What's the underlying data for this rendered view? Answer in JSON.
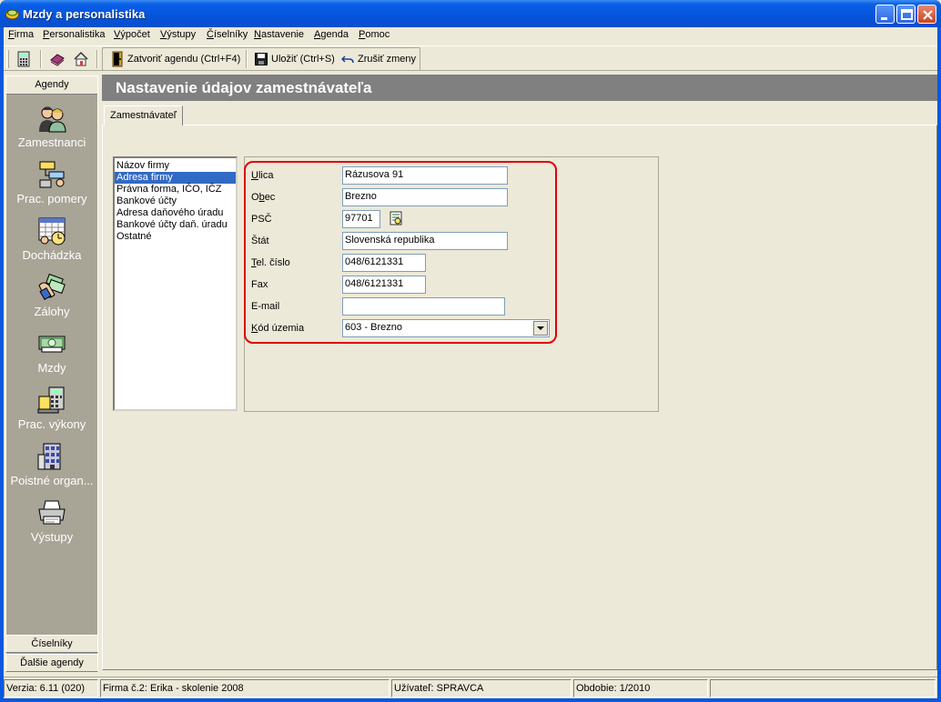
{
  "window": {
    "title": "Mzdy a personalistika"
  },
  "menu": [
    {
      "label": "Firma",
      "key": "F",
      "rest": "irma"
    },
    {
      "label": "Personalistika",
      "key": "P",
      "rest": "ersonalistika"
    },
    {
      "label": "Výpočet",
      "key": "V",
      "rest": "ýpočet"
    },
    {
      "label": "Výstupy",
      "key": "V",
      "rest": "ýstupy"
    },
    {
      "label": "Číselníky",
      "key": "Č",
      "rest": "íselníky"
    },
    {
      "label": "Nastavenie",
      "key": "N",
      "rest": "astavenie"
    },
    {
      "label": "Agenda",
      "key": "A",
      "rest": "genda"
    },
    {
      "label": "Pomoc",
      "key": "P",
      "rest": "omoc"
    }
  ],
  "toolbar": {
    "close_agenda": "Zatvoriť agendu (Ctrl+F4)",
    "save": "Uložiť (Ctrl+S)",
    "undo": "Zrušiť zmeny"
  },
  "sidebar": {
    "header": "Agendy",
    "items": [
      {
        "label": "Zamestnanci",
        "icon": "employees-icon"
      },
      {
        "label": "Prac. pomery",
        "icon": "org-chart-icon"
      },
      {
        "label": "Dochádzka",
        "icon": "attendance-calendar-icon"
      },
      {
        "label": "Zálohy",
        "icon": "cash-advance-icon"
      },
      {
        "label": "Mzdy",
        "icon": "money-icon"
      },
      {
        "label": "Prac. výkony",
        "icon": "work-performance-icon"
      },
      {
        "label": "Poistné organ...",
        "icon": "insurance-building-icon"
      },
      {
        "label": "Výstupy",
        "icon": "printer-icon"
      }
    ],
    "footer": [
      "Číselníky",
      "Ďalšie agendy"
    ]
  },
  "main": {
    "title": "Nastavenie údajov zamestnávateľa",
    "tab": "Zamestnávateľ",
    "sections": [
      "Názov firmy",
      "Adresa firmy",
      "Právna forma, IČO, IČZ",
      "Bankové účty",
      "Adresa daňového úradu",
      "Bankové účty daň. úradu",
      "Ostatné"
    ],
    "selected_section": 1,
    "form": {
      "ulica": {
        "key": "U",
        "rest": "lica",
        "value": "Rázusova 91"
      },
      "obec": {
        "pre": "O",
        "key": "b",
        "rest": "ec",
        "value": "Brezno"
      },
      "psc": {
        "label": "PSČ",
        "value": "97701"
      },
      "stat": {
        "label": "Štát",
        "value": "Slovenská republika"
      },
      "tel": {
        "key": "T",
        "rest": "el. číslo",
        "value": "048/6121331"
      },
      "fax": {
        "label": "Fax",
        "value": "048/6121331"
      },
      "email": {
        "label": "E-mail",
        "value": ""
      },
      "kod": {
        "key": "K",
        "rest": "ód územia",
        "value": "603 - Brezno"
      }
    }
  },
  "status": {
    "version": "Verzia: 6.11 (020)",
    "company": "Firma č.2: Erika  - skolenie 2008",
    "user": "Užívateľ: SPRAVCA",
    "period": "Obdobie: 1/2010"
  }
}
